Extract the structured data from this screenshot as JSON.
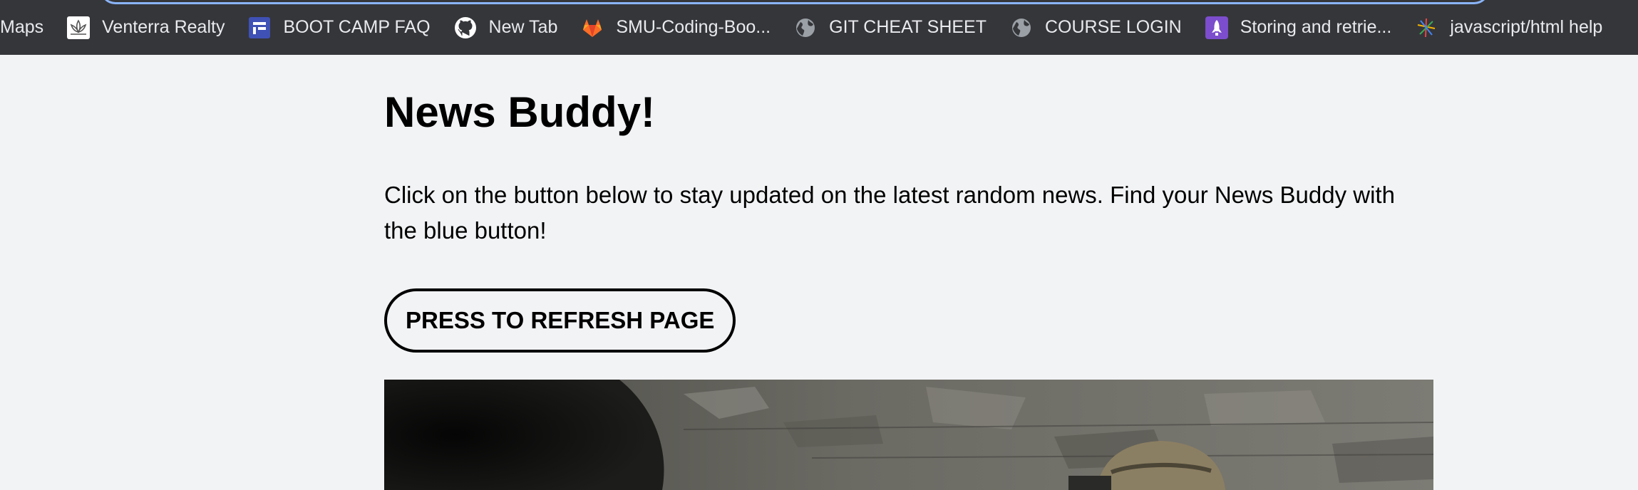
{
  "browser": {
    "bookmarks": [
      {
        "label": "Maps",
        "icon": "maps-icon"
      },
      {
        "label": "Venterra Realty",
        "icon": "venterra-lotus-icon"
      },
      {
        "label": "BOOT CAMP FAQ",
        "icon": "faq-site-icon"
      },
      {
        "label": "New Tab",
        "icon": "github-icon"
      },
      {
        "label": "SMU-Coding-Boo...",
        "icon": "gitlab-icon"
      },
      {
        "label": "GIT CHEAT SHEET",
        "icon": "globe-icon"
      },
      {
        "label": "COURSE LOGIN",
        "icon": "globe-icon"
      },
      {
        "label": "Storing and retrie...",
        "icon": "rocket-icon"
      },
      {
        "label": "javascript/html help",
        "icon": "sparkle-icon"
      }
    ]
  },
  "page": {
    "title": "News Buddy!",
    "intro": "Click on the button below to stay updated on the latest random news. Find your News Buddy with the blue button!",
    "refresh_button": "PRESS TO REFRESH PAGE"
  },
  "colors": {
    "bookmarks_bar": "#35363a",
    "page_background": "#f2f3f5",
    "omnibox_focus_ring": "#8ab4f8"
  }
}
